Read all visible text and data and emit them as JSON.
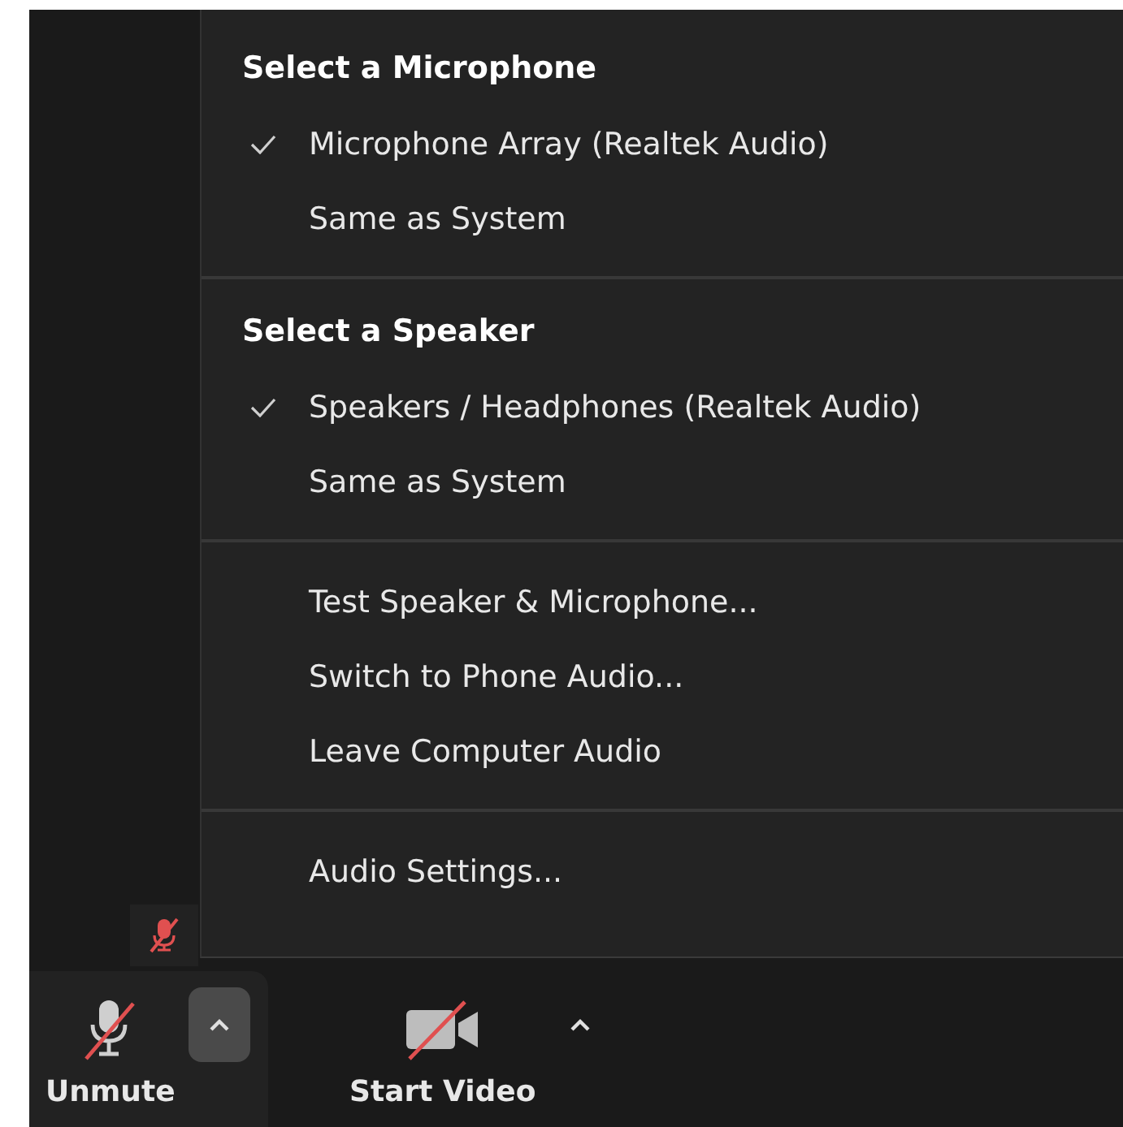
{
  "menu": {
    "sections": [
      {
        "header": "Select a Microphone",
        "items": [
          {
            "label": "Microphone Array (Realtek Audio)",
            "selected": true
          },
          {
            "label": "Same as System",
            "selected": false
          }
        ]
      },
      {
        "header": "Select a Speaker",
        "items": [
          {
            "label": "Speakers / Headphones (Realtek Audio)",
            "selected": true
          },
          {
            "label": "Same as System",
            "selected": false
          }
        ]
      },
      {
        "items": [
          {
            "label": "Test Speaker & Microphone...",
            "selected": false
          },
          {
            "label": "Switch to Phone Audio...",
            "selected": false
          },
          {
            "label": "Leave Computer Audio",
            "selected": false
          }
        ]
      },
      {
        "items": [
          {
            "label": "Audio Settings...",
            "selected": false
          }
        ]
      }
    ]
  },
  "participant": {
    "muted": true
  },
  "toolbar": {
    "buttons": [
      {
        "kind": "mic",
        "label": "Unmute",
        "off": true
      },
      {
        "kind": "video",
        "label": "Start Video",
        "off": true
      }
    ]
  }
}
